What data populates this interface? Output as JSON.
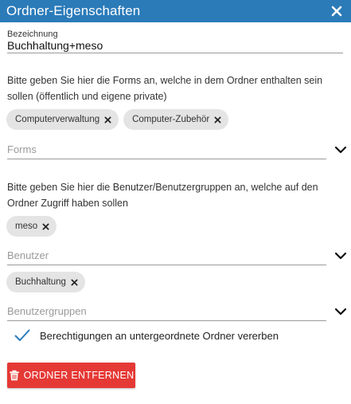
{
  "dialog": {
    "title": "Ordner-Eigenschaften",
    "close_icon": "close-icon"
  },
  "name_field": {
    "label": "Bezeichnung",
    "value": "Buchhaltung+meso"
  },
  "forms_section": {
    "description": "Bitte geben Sie hier die Forms an, welche in dem Ordner enthalten sein sollen (öffentlich und eigene private)",
    "chips": [
      "Computerverwaltung",
      "Computer-Zubehör"
    ],
    "placeholder": "Forms"
  },
  "users_section": {
    "description": "Bitte geben Sie hier die Benutzer/Benutzergruppen an, welche auf den Ordner Zugriff haben sollen",
    "user_chips": [
      "meso"
    ],
    "user_placeholder": "Benutzer",
    "group_chips": [
      "Buchhaltung"
    ],
    "group_placeholder": "Benutzergruppen"
  },
  "inherit": {
    "checked": true,
    "label": "Berechtigungen an untergeordnete Ordner vererben"
  },
  "delete_button": {
    "label": "ORDNER ENTFERNEN",
    "icon": "trash-icon"
  },
  "colors": {
    "titlebar": "#2b7bb9",
    "accent": "#2b7bb9",
    "danger": "#e53935",
    "chip": "#e4e4e4"
  }
}
